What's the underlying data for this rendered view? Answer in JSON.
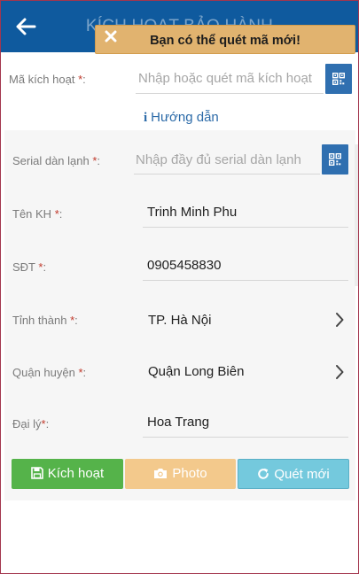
{
  "header": {
    "title": "KÍCH HOẠT BẢO HÀNH",
    "back_icon": "arrow-left-icon"
  },
  "toast": {
    "message": "Bạn có thể quét mã mới!",
    "close_icon": "close-icon"
  },
  "activation_code": {
    "label": "Mã kích hoạt",
    "required_mark": "*",
    "colon": ":",
    "placeholder": "Nhập hoặc quét mã kích hoạt",
    "scan_icon": "qr-code-icon"
  },
  "guide": {
    "icon": "i",
    "label": "Hướng dẫn"
  },
  "serial": {
    "label": "Serial dàn lạnh",
    "required_mark": "*",
    "colon": ":",
    "placeholder": "Nhập đầy đủ serial dàn lạnh",
    "scan_icon": "qr-code-icon"
  },
  "customer_name": {
    "label": "Tên KH",
    "required_mark": "*",
    "colon": ":",
    "value": "Trinh Minh Phu"
  },
  "phone": {
    "label": "SĐT",
    "required_mark": "*",
    "colon": ":",
    "value": "0905458830"
  },
  "province": {
    "label": "Tỉnh thành",
    "required_mark": "*",
    "colon": ":",
    "value": "TP. Hà Nội"
  },
  "district": {
    "label": "Quận huyện",
    "required_mark": "*",
    "colon": ":",
    "value": "Quận Long Biên"
  },
  "dealer": {
    "label": "Đại lý",
    "required_mark": "*",
    "colon": ":",
    "value": "Hoa Trang"
  },
  "actions": {
    "activate_label": "Kích hoạt",
    "photo_label": "Photo",
    "rescan_label": "Quét mới"
  },
  "colors": {
    "header": "#0f5a9e",
    "toast": "#e1b36f",
    "activate": "#55b34a",
    "photo": "#f3c98c",
    "rescan": "#74c9dd",
    "qr_button": "#2f6fb0",
    "required": "#c0392b"
  }
}
